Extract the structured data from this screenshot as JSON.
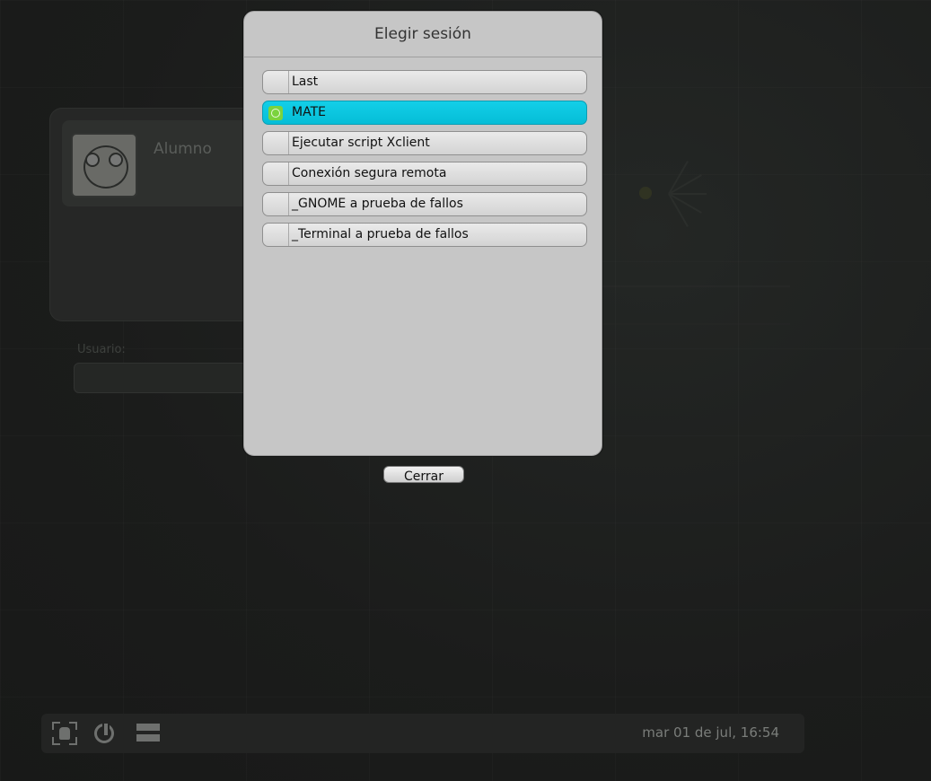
{
  "login_screen": {
    "user": {
      "name": "Alumno"
    },
    "username_field": {
      "label": "Usuario:",
      "value": ""
    }
  },
  "session_dialog": {
    "title": "Elegir sesión",
    "sessions": [
      {
        "label": "Last",
        "icon": "none",
        "selected": false
      },
      {
        "label": "MATE",
        "icon": "mate-logo-icon",
        "selected": true
      },
      {
        "label": "Ejecutar script Xclient",
        "icon": "none",
        "selected": false
      },
      {
        "label": "Conexión segura remota",
        "icon": "none",
        "selected": false
      },
      {
        "label": "_GNOME a prueba de fallos",
        "icon": "none",
        "selected": false
      },
      {
        "label": "_Terminal a prueba de fallos",
        "icon": "none",
        "selected": false
      }
    ],
    "close_label": "Cerrar"
  },
  "bottom_bar": {
    "icons": [
      "accessibility-icon",
      "power-icon",
      "keyboard-layout-icon"
    ],
    "clock": "mar 01 de jul, 16:54"
  },
  "colors": {
    "selected_session": "#05bdd7",
    "dialog_bg": "#c6c6c6",
    "mate_badge": "#7bd33d"
  }
}
